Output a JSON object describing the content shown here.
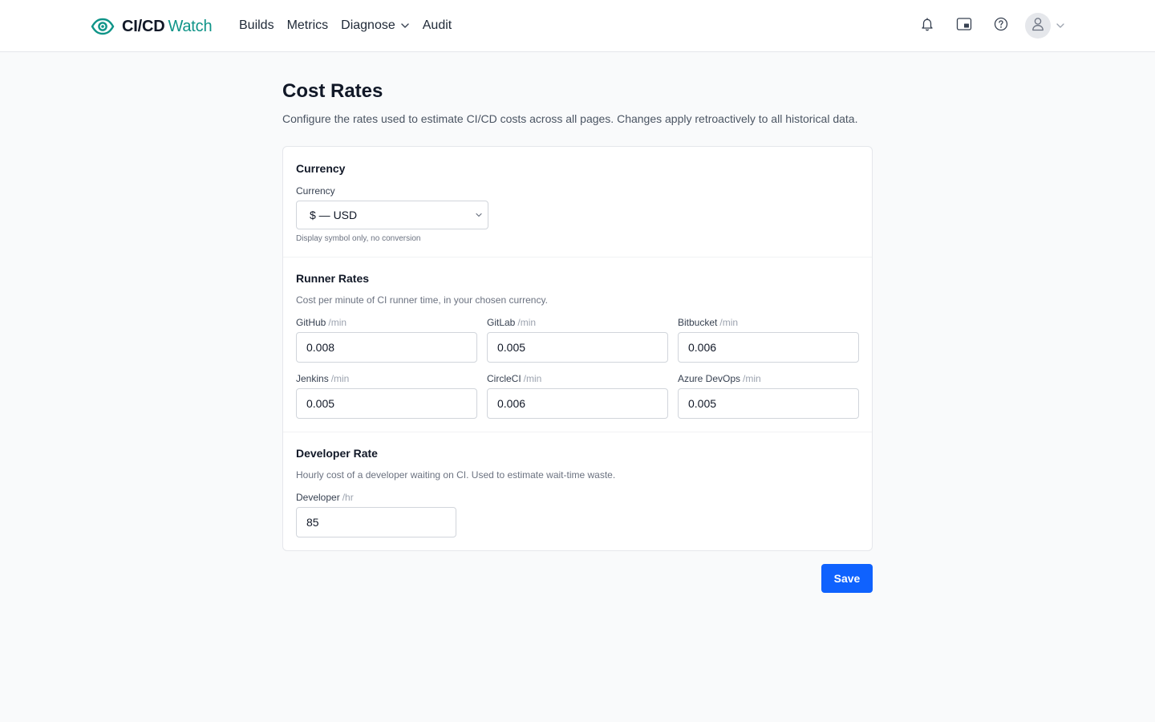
{
  "app": {
    "name_bold": "CI/CD",
    "name_accent": "Watch",
    "accent_color": "#0f9488"
  },
  "nav": {
    "items": [
      {
        "label": "Builds",
        "icon": null
      },
      {
        "label": "Metrics",
        "icon": null
      },
      {
        "label": "Diagnose",
        "icon": "chevron-down-icon"
      },
      {
        "label": "Audit",
        "icon": null
      }
    ]
  },
  "header_icons": [
    "bell-icon",
    "picture-in-picture-icon",
    "help-circle-icon",
    "user-avatar-icon",
    "chevron-down-icon"
  ],
  "page": {
    "title": "Cost Rates",
    "description": "Configure the rates used to estimate CI/CD costs across all pages. Changes apply retroactively to all historical data."
  },
  "currency_section": {
    "title": "Currency",
    "field_label": "Currency",
    "selected": "$ — USD",
    "hint": "Display symbol only, no conversion"
  },
  "runner_section": {
    "title": "Runner Rates",
    "description": "Cost per minute of CI runner time, in your chosen currency.",
    "rates": [
      {
        "label": "GitHub",
        "unit": "/min",
        "value": "0.008"
      },
      {
        "label": "GitLab",
        "unit": "/min",
        "value": "0.005"
      },
      {
        "label": "Bitbucket",
        "unit": "/min",
        "value": "0.006"
      },
      {
        "label": "Jenkins",
        "unit": "/min",
        "value": "0.005"
      },
      {
        "label": "CircleCI",
        "unit": "/min",
        "value": "0.006"
      },
      {
        "label": "Azure DevOps",
        "unit": "/min",
        "value": "0.005"
      }
    ]
  },
  "developer_section": {
    "title": "Developer Rate",
    "description": "Hourly cost of a developer waiting on CI. Used to estimate wait-time waste.",
    "field_label": "Developer",
    "unit": "/hr",
    "value": "85"
  },
  "actions": {
    "save_label": "Save",
    "primary_color": "#0f62fe"
  }
}
